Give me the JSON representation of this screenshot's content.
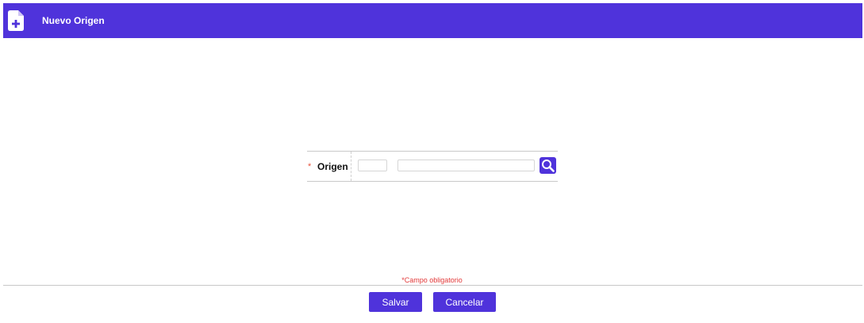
{
  "header": {
    "title": "Nuevo Origen",
    "icon": "new-document-icon",
    "background": "#4f33db"
  },
  "form": {
    "required_mark": "*",
    "origin_label": "Origen",
    "origin_code_value": "",
    "origin_description_value": "",
    "search_icon": "search-icon"
  },
  "footer": {
    "required_note": "*Campo obligatorio",
    "save_label": "Salvar",
    "cancel_label": "Cancelar"
  }
}
